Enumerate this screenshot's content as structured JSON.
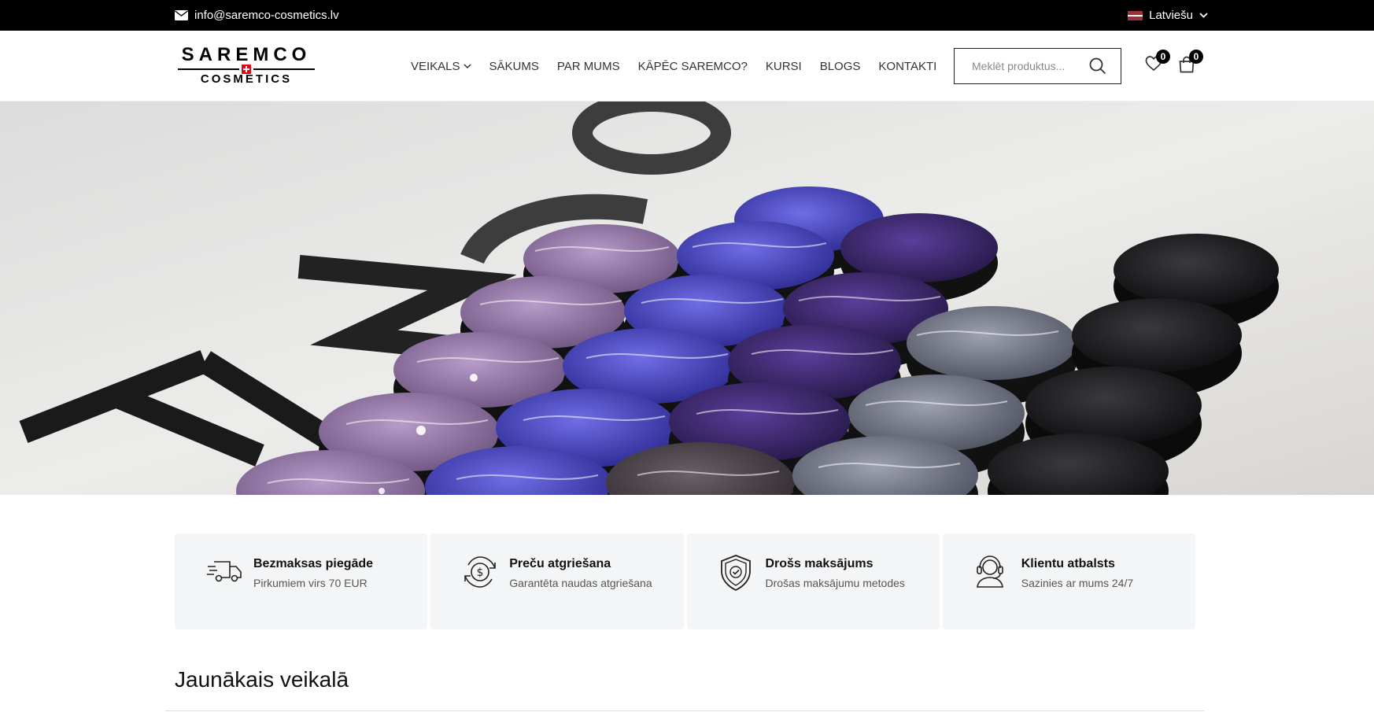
{
  "topbar": {
    "email": "info@saremco-cosmetics.lv",
    "language": "Latviešu"
  },
  "header": {
    "logo": {
      "brand": "SAREMCO",
      "sub": "COSMETICS"
    },
    "nav": [
      "VEIKALS",
      "SĀKUMS",
      "PAR MUMS",
      "KĀPĒC SAREMCO?",
      "KURSI",
      "BLOGS",
      "KONTAKTI"
    ],
    "search_placeholder": "Meklēt produktus...",
    "wishlist_count": "0",
    "cart_count": "0"
  },
  "features": [
    {
      "title": "Bezmaksas piegāde",
      "desc": "Pirkumiem virs 70 EUR",
      "icon": "truck-icon"
    },
    {
      "title": "Preču atgriešana",
      "desc": "Garantēta naudas atgriešana",
      "icon": "money-return-icon"
    },
    {
      "title": "Drošs maksājums",
      "desc": "Drošas maksājumu metodes",
      "icon": "shield-check-icon"
    },
    {
      "title": "Klientu atbalsts",
      "desc": "Sazinies ar mums 24/7",
      "icon": "headset-icon"
    }
  ],
  "section": {
    "title": "Jaunākais veikalā"
  },
  "colors": {
    "topbar": "#000000",
    "feature_bg": "#f4f5f6"
  }
}
